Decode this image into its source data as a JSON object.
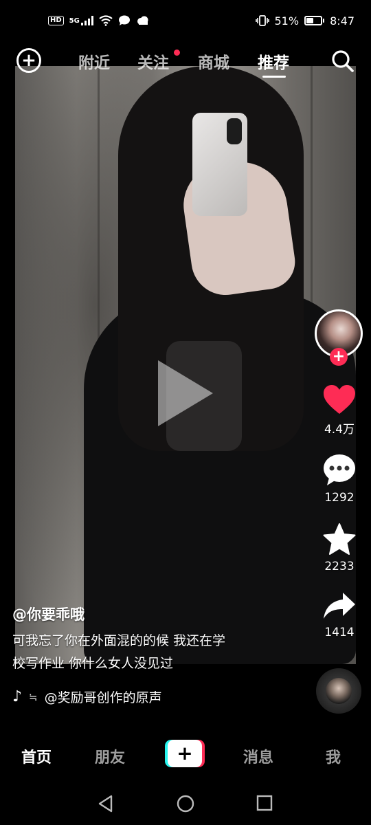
{
  "status_bar": {
    "hd": "HD",
    "network": "5G",
    "battery_pct": "51%",
    "battery_level": 0.51,
    "time": "8:47"
  },
  "top_nav": {
    "tabs": [
      {
        "label": "附近",
        "active": false
      },
      {
        "label": "关注",
        "active": false,
        "has_dot": true
      },
      {
        "label": "商城",
        "active": false
      },
      {
        "label": "推荐",
        "active": true
      }
    ]
  },
  "rail": {
    "likes": "4.4万",
    "comments": "1292",
    "favorites": "2233",
    "shares": "1414",
    "follow_symbol": "+"
  },
  "caption": {
    "author": "@你要乖哦",
    "line1": "可我忘了你在外面混的的候 我还在学",
    "line2": "校写作业 你什么女人没见过"
  },
  "music": {
    "note": "♪",
    "wave": "≒",
    "title": "@奖励哥创作的原声"
  },
  "tab_bar": {
    "items": [
      {
        "label": "首页",
        "active": true
      },
      {
        "label": "朋友",
        "active": false
      },
      {
        "label": "消息",
        "active": false
      },
      {
        "label": "我",
        "active": false
      }
    ],
    "create_symbol": "+"
  },
  "icons": {
    "like": "heart-icon",
    "comment": "comment-bubble-icon",
    "favorite": "star-icon",
    "share": "share-arrow-icon",
    "search": "search-icon",
    "add": "add-circle-icon"
  },
  "colors": {
    "like_red": "#fe2c55",
    "accent_cyan": "#25f4ee"
  }
}
